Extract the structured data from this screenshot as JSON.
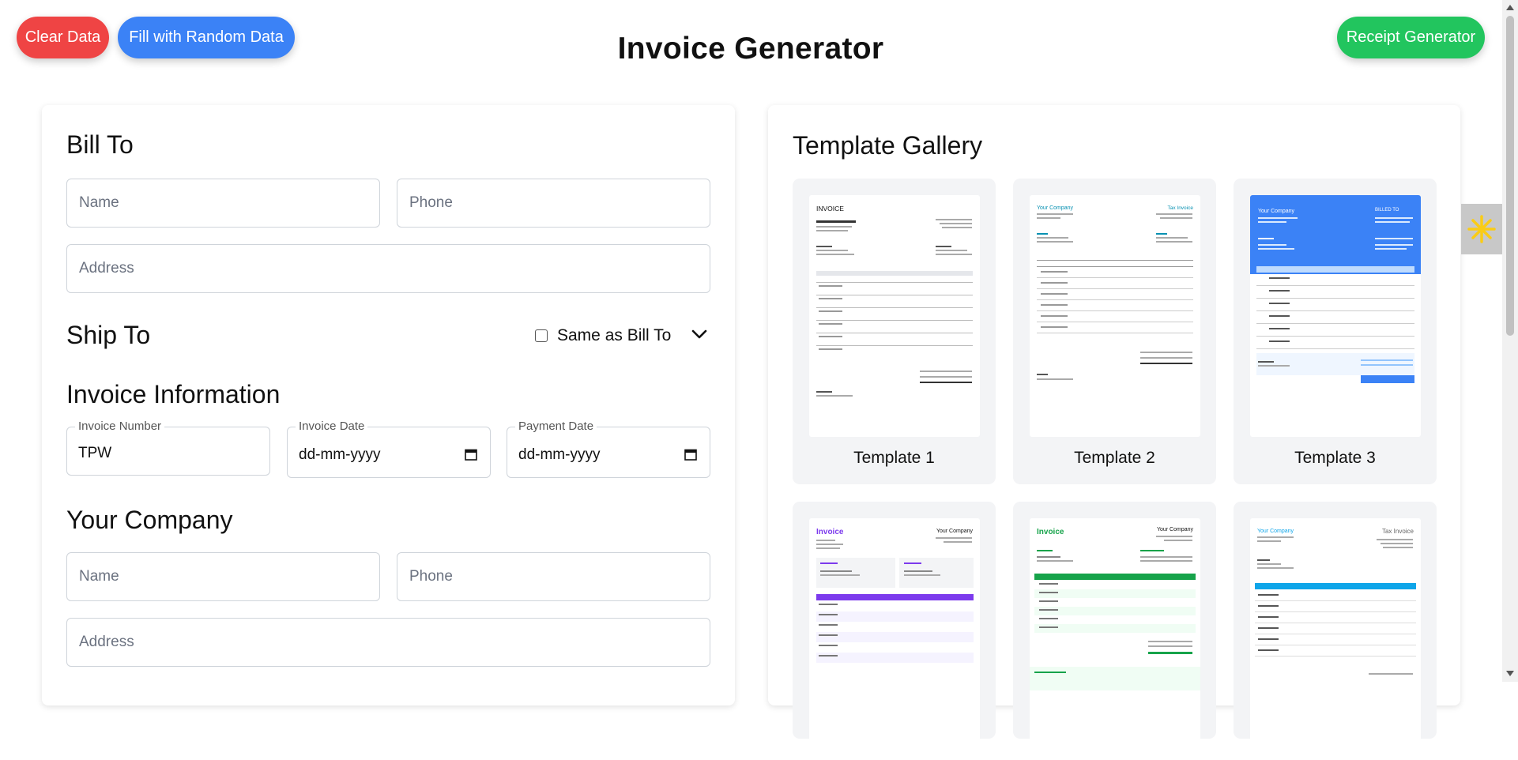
{
  "header": {
    "title": "Invoice Generator",
    "clear_label": "Clear Data",
    "random_label": "Fill with Random Data",
    "receipt_label": "Receipt Generator"
  },
  "colors": {
    "clear": "#ef4444",
    "random": "#3b82f6",
    "receipt": "#22c55e"
  },
  "form": {
    "bill_to": {
      "title": "Bill To",
      "name_ph": "Name",
      "phone_ph": "Phone",
      "address_ph": "Address"
    },
    "ship_to": {
      "title": "Ship To",
      "same_label": "Same as Bill To"
    },
    "invoice_info": {
      "title": "Invoice Information",
      "number_label": "Invoice Number",
      "number_value": "TPW",
      "date_label": "Invoice Date",
      "date_placeholder": "dd-mm-yyyy",
      "payment_label": "Payment Date",
      "payment_placeholder": "dd-mm-yyyy"
    },
    "company": {
      "title": "Your Company",
      "name_ph": "Name",
      "phone_ph": "Phone",
      "address_ph": "Address"
    }
  },
  "gallery": {
    "title": "Template Gallery",
    "templates": [
      {
        "name": "Template 1",
        "heading": "INVOICE"
      },
      {
        "name": "Template 2",
        "heading": "Your Company",
        "tag": "Tax Invoice"
      },
      {
        "name": "Template 3",
        "heading": "Your Company",
        "tag": "BILLED TO"
      },
      {
        "heading": "Invoice",
        "company": "Your Company"
      },
      {
        "heading": "Invoice",
        "company": "Your Company"
      },
      {
        "heading": "Your Company",
        "tag": "Tax Invoice"
      }
    ]
  },
  "icons": [
    "calendar-icon",
    "chevron-down-icon",
    "sun-icon"
  ]
}
